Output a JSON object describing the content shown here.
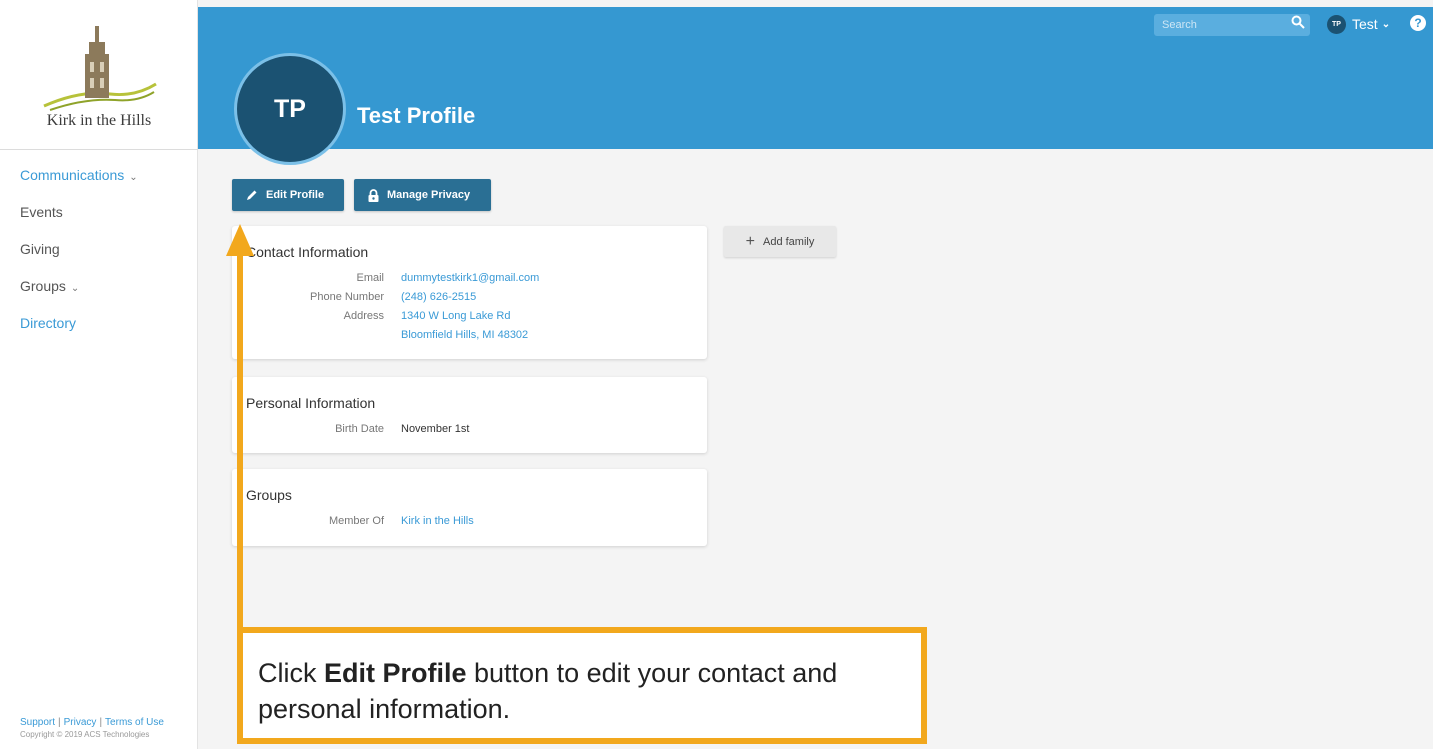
{
  "brand": {
    "name": "Kirk in the Hills",
    "accent": "#3598d1",
    "dark_accent": "#1b5272"
  },
  "sidebar": {
    "items": [
      {
        "label": "Communications",
        "chevron": true
      },
      {
        "label": "Events"
      },
      {
        "label": "Giving"
      },
      {
        "label": "Groups",
        "chevron": true
      },
      {
        "label": "Directory",
        "active": true
      }
    ],
    "footer": {
      "links": [
        "Support",
        "Privacy",
        "Terms of Use"
      ],
      "copyright": "Copyright © 2019 ACS Technologies"
    }
  },
  "header": {
    "search_placeholder": "Search",
    "user_initials": "TP",
    "user_name": "Test",
    "help_label": "?"
  },
  "profile": {
    "initials": "TP",
    "name": "Test Profile"
  },
  "actions": {
    "edit_profile": "Edit Profile",
    "manage_privacy": "Manage Privacy",
    "add_family": "Add family"
  },
  "contact": {
    "title": "Contact Information",
    "email_label": "Email",
    "email": "dummytestkirk1@gmail.com",
    "phone_label": "Phone Number",
    "phone": "(248) 626-2515",
    "address_label": "Address",
    "address_line1": "1340 W Long Lake Rd",
    "address_line2": "Bloomfield Hills, MI 48302"
  },
  "personal": {
    "title": "Personal Information",
    "birth_label": "Birth Date",
    "birth_date": "November 1st"
  },
  "groups": {
    "title": "Groups",
    "member_label": "Member Of",
    "member_of": "Kirk in the Hills"
  },
  "annotation": {
    "prefix": "Click ",
    "bold": "Edit Profile",
    "suffix": " button to edit your contact and personal information.",
    "color": "#f2a81d"
  }
}
